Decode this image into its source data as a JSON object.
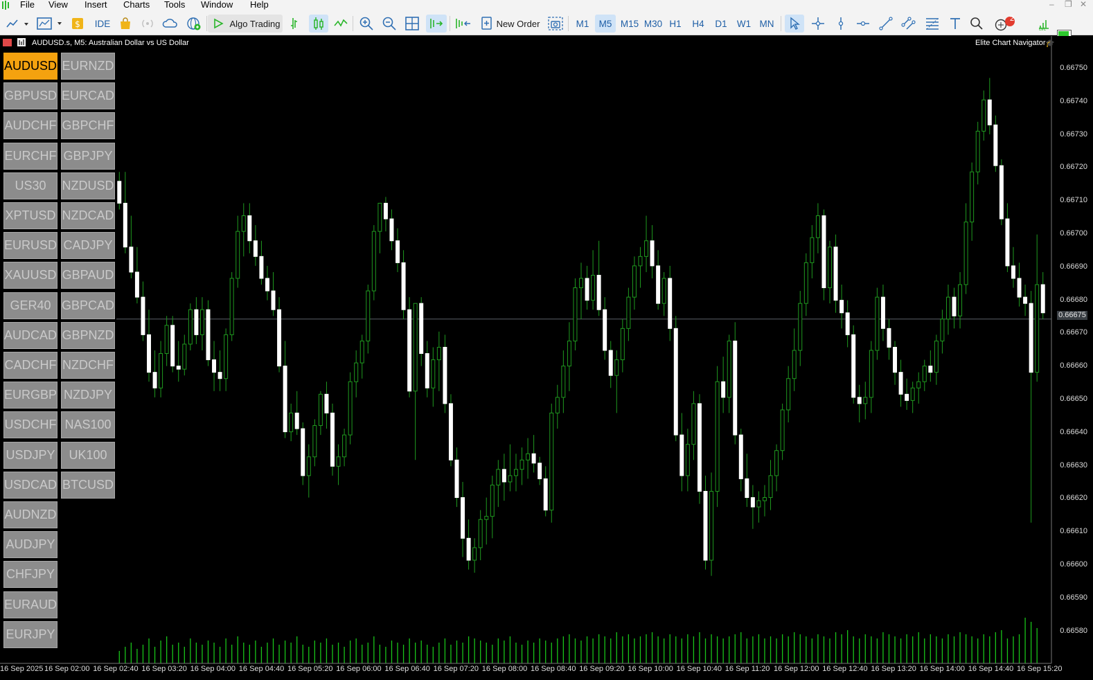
{
  "menu": [
    "File",
    "View",
    "Insert",
    "Charts",
    "Tools",
    "Window",
    "Help"
  ],
  "toolbar": {
    "ide": "IDE",
    "algo_trading": "Algo Trading",
    "new_order": "New Order",
    "timeframes": [
      "M1",
      "M5",
      "M15",
      "M30",
      "H1",
      "H4",
      "D1",
      "W1",
      "MN"
    ],
    "active_timeframe": "M5",
    "notification_count": "2"
  },
  "chart": {
    "title": "AUDUSD.s, M5:  Australian Dollar vs US Dollar",
    "navigator_label": "Elite Chart Navigator",
    "current_price": "0.66675",
    "price_ticks": [
      "0.66750",
      "0.66740",
      "0.66730",
      "0.66720",
      "0.66710",
      "0.66700",
      "0.66690",
      "0.66680",
      "0.66670",
      "0.66660",
      "0.66650",
      "0.66640",
      "0.66630",
      "0.66620",
      "0.66610",
      "0.66600",
      "0.66590",
      "0.66580"
    ],
    "time_ticks": [
      "16 Sep 2025",
      "16 Sep 02:00",
      "16 Sep 02:40",
      "16 Sep 03:20",
      "16 Sep 04:00",
      "16 Sep 04:40",
      "16 Sep 05:20",
      "16 Sep 06:00",
      "16 Sep 06:40",
      "16 Sep 07:20",
      "16 Sep 08:00",
      "16 Sep 08:40",
      "16 Sep 09:20",
      "16 Sep 10:00",
      "16 Sep 10:40",
      "16 Sep 11:20",
      "16 Sep 12:00",
      "16 Sep 12:40",
      "16 Sep 13:20",
      "16 Sep 14:00",
      "16 Sep 14:40",
      "16 Sep 15:20"
    ]
  },
  "symbols_col1": [
    "AUDUSD",
    "GBPUSD",
    "AUDCHF",
    "EURCHF",
    "US30",
    "XPTUSD",
    "EURUSD",
    "XAUUSD",
    "GER40",
    "AUDCAD",
    "CADCHF",
    "EURGBP",
    "USDCHF",
    "USDJPY",
    "USDCAD",
    "AUDNZD",
    "AUDJPY",
    "CHFJPY",
    "EURAUD",
    "EURJPY"
  ],
  "symbols_col2": [
    "EURNZD",
    "EURCAD",
    "GBPCHF",
    "GBPJPY",
    "NZDUSD",
    "NZDCAD",
    "CADJPY",
    "GBPAUD",
    "GBPCAD",
    "GBPNZD",
    "NZDCHF",
    "NZDJPY",
    "NAS100",
    "UK100",
    "BTCUSD"
  ],
  "active_symbol": "AUDUSD",
  "colors": {
    "candle_up": "#ffffff",
    "candle_down": "#ffffff",
    "wick": "#1f9a1f",
    "volume": "#19c419",
    "active_button": "#f4a20f"
  },
  "chart_data": {
    "type": "candlestick",
    "symbol": "AUDUSD.s",
    "timeframe": "M5",
    "ylim": [
      0.66575,
      0.66755
    ],
    "candles": [
      [
        0.66719,
        0.66722,
        0.6671,
        0.66712
      ],
      [
        0.66712,
        0.66722,
        0.66696,
        0.66698
      ],
      [
        0.66698,
        0.66708,
        0.66688,
        0.6669
      ],
      [
        0.6669,
        0.66698,
        0.6668,
        0.66682
      ],
      [
        0.66682,
        0.66687,
        0.66668,
        0.6667
      ],
      [
        0.6667,
        0.66678,
        0.66655,
        0.66658
      ],
      [
        0.66658,
        0.66665,
        0.6665,
        0.66653
      ],
      [
        0.66653,
        0.66668,
        0.6665,
        0.66664
      ],
      [
        0.66664,
        0.66676,
        0.6666,
        0.66673
      ],
      [
        0.66673,
        0.66676,
        0.66658,
        0.6666
      ],
      [
        0.6666,
        0.66668,
        0.66655,
        0.66659
      ],
      [
        0.66659,
        0.6667,
        0.66657,
        0.66667
      ],
      [
        0.66667,
        0.6668,
        0.66665,
        0.66678
      ],
      [
        0.66678,
        0.66682,
        0.66667,
        0.6667
      ],
      [
        0.6667,
        0.66682,
        0.66665,
        0.66678
      ],
      [
        0.66678,
        0.66681,
        0.6666,
        0.66662
      ],
      [
        0.66662,
        0.66668,
        0.66652,
        0.66658
      ],
      [
        0.66658,
        0.66665,
        0.66652,
        0.66656
      ],
      [
        0.66656,
        0.66672,
        0.66652,
        0.6667
      ],
      [
        0.6667,
        0.6669,
        0.66668,
        0.66688
      ],
      [
        0.66688,
        0.66708,
        0.66685,
        0.66703
      ],
      [
        0.66703,
        0.66712,
        0.66695,
        0.66708
      ],
      [
        0.66708,
        0.66712,
        0.66696,
        0.667
      ],
      [
        0.667,
        0.66705,
        0.66692,
        0.66695
      ],
      [
        0.66695,
        0.667,
        0.66686,
        0.66688
      ],
      [
        0.66688,
        0.66692,
        0.66681,
        0.66684
      ],
      [
        0.66684,
        0.6669,
        0.66676,
        0.66678
      ],
      [
        0.66678,
        0.66682,
        0.66658,
        0.6666
      ],
      [
        0.6666,
        0.66668,
        0.66637,
        0.66639
      ],
      [
        0.66639,
        0.66648,
        0.66636,
        0.66645
      ],
      [
        0.66645,
        0.66652,
        0.66638,
        0.6664
      ],
      [
        0.6664,
        0.66642,
        0.66622,
        0.66625
      ],
      [
        0.66625,
        0.66635,
        0.66618,
        0.66631
      ],
      [
        0.66631,
        0.66643,
        0.66628,
        0.66641
      ],
      [
        0.66641,
        0.66652,
        0.66638,
        0.66651
      ],
      [
        0.66651,
        0.66655,
        0.6664,
        0.66645
      ],
      [
        0.66645,
        0.66648,
        0.66625,
        0.66628
      ],
      [
        0.66628,
        0.66635,
        0.66622,
        0.66631
      ],
      [
        0.66631,
        0.6664,
        0.66628,
        0.66638
      ],
      [
        0.66638,
        0.66658,
        0.66635,
        0.66655
      ],
      [
        0.66655,
        0.66665,
        0.6665,
        0.66661
      ],
      [
        0.66661,
        0.6667,
        0.66656,
        0.66668
      ],
      [
        0.66668,
        0.66686,
        0.66664,
        0.66684
      ],
      [
        0.66684,
        0.66705,
        0.66681,
        0.66703
      ],
      [
        0.66703,
        0.66712,
        0.66696,
        0.66712
      ],
      [
        0.66712,
        0.66714,
        0.66703,
        0.66707
      ],
      [
        0.66707,
        0.6671,
        0.66697,
        0.667
      ],
      [
        0.667,
        0.66704,
        0.6669,
        0.66693
      ],
      [
        0.66693,
        0.66697,
        0.66675,
        0.66678
      ],
      [
        0.66678,
        0.66682,
        0.6665,
        0.66652
      ],
      [
        0.66652,
        0.66668,
        0.6663,
        0.6668
      ],
      [
        0.6668,
        0.66682,
        0.6666,
        0.66664
      ],
      [
        0.66664,
        0.66668,
        0.6665,
        0.66653
      ],
      [
        0.66653,
        0.66666,
        0.66647,
        0.66662
      ],
      [
        0.66662,
        0.66671,
        0.66652,
        0.66666
      ],
      [
        0.66666,
        0.6667,
        0.66645,
        0.66648
      ],
      [
        0.66648,
        0.66651,
        0.66628,
        0.6663
      ],
      [
        0.6663,
        0.66634,
        0.66615,
        0.66618
      ],
      [
        0.66618,
        0.66623,
        0.66599,
        0.66605
      ],
      [
        0.66605,
        0.66611,
        0.66595,
        0.66598
      ],
      [
        0.66598,
        0.66605,
        0.66594,
        0.66602
      ],
      [
        0.66602,
        0.66614,
        0.66598,
        0.66611
      ],
      [
        0.66611,
        0.66618,
        0.66603,
        0.66612
      ],
      [
        0.66612,
        0.66625,
        0.66605,
        0.66622
      ],
      [
        0.66622,
        0.6663,
        0.66615,
        0.66627
      ],
      [
        0.66627,
        0.66632,
        0.66617,
        0.66623
      ],
      [
        0.66623,
        0.66635,
        0.6662,
        0.66625
      ],
      [
        0.66625,
        0.66632,
        0.6662,
        0.66627
      ],
      [
        0.66627,
        0.66634,
        0.66622,
        0.6663
      ],
      [
        0.6663,
        0.66637,
        0.66624,
        0.66632
      ],
      [
        0.66632,
        0.66638,
        0.66626,
        0.66629
      ],
      [
        0.66629,
        0.66631,
        0.66622,
        0.66624
      ],
      [
        0.66624,
        0.66628,
        0.66612,
        0.66614
      ],
      [
        0.66614,
        0.66648,
        0.6661,
        0.66645
      ],
      [
        0.66645,
        0.66654,
        0.6664,
        0.6665
      ],
      [
        0.6665,
        0.66665,
        0.66645,
        0.6666
      ],
      [
        0.6666,
        0.66674,
        0.66652,
        0.66668
      ],
      [
        0.66668,
        0.66688,
        0.66665,
        0.66685
      ],
      [
        0.66685,
        0.66693,
        0.66675,
        0.66688
      ],
      [
        0.66688,
        0.66692,
        0.66678,
        0.66681
      ],
      [
        0.66681,
        0.66697,
        0.66678,
        0.66689
      ],
      [
        0.66689,
        0.667,
        0.66676,
        0.66678
      ],
      [
        0.66678,
        0.66682,
        0.66662,
        0.66665
      ],
      [
        0.66665,
        0.66668,
        0.66653,
        0.66657
      ],
      [
        0.66657,
        0.66665,
        0.66645,
        0.66662
      ],
      [
        0.66662,
        0.66675,
        0.66658,
        0.66672
      ],
      [
        0.66672,
        0.66685,
        0.66668,
        0.66682
      ],
      [
        0.66682,
        0.66695,
        0.66678,
        0.66692
      ],
      [
        0.66692,
        0.66698,
        0.66685,
        0.66695
      ],
      [
        0.66695,
        0.66708,
        0.6669,
        0.667
      ],
      [
        0.667,
        0.66705,
        0.66688,
        0.66692
      ],
      [
        0.66692,
        0.66697,
        0.66678,
        0.6668
      ],
      [
        0.6668,
        0.6669,
        0.66676,
        0.66688
      ],
      [
        0.66688,
        0.66692,
        0.66668,
        0.66672
      ],
      [
        0.66672,
        0.66676,
        0.66636,
        0.66638
      ],
      [
        0.66638,
        0.66645,
        0.6662,
        0.66625
      ],
      [
        0.66625,
        0.6664,
        0.6662,
        0.66635
      ],
      [
        0.66635,
        0.66652,
        0.6663,
        0.66648
      ],
      [
        0.66648,
        0.66651,
        0.66616,
        0.6662
      ],
      [
        0.6662,
        0.66625,
        0.66595,
        0.66598
      ],
      [
        0.66598,
        0.66626,
        0.66593,
        0.6662
      ],
      [
        0.6662,
        0.6666,
        0.66615,
        0.66655
      ],
      [
        0.66655,
        0.66663,
        0.66645,
        0.6665
      ],
      [
        0.6665,
        0.6667,
        0.66645,
        0.66668
      ],
      [
        0.66668,
        0.66674,
        0.66635,
        0.66638
      ],
      [
        0.66638,
        0.6664,
        0.6662,
        0.66624
      ],
      [
        0.66624,
        0.66632,
        0.66615,
        0.66618
      ],
      [
        0.66618,
        0.66622,
        0.66608,
        0.66615
      ],
      [
        0.66615,
        0.6662,
        0.6661,
        0.66617
      ],
      [
        0.66617,
        0.66622,
        0.66612,
        0.66618
      ],
      [
        0.66618,
        0.6663,
        0.66614,
        0.66625
      ],
      [
        0.66625,
        0.66635,
        0.6662,
        0.66633
      ],
      [
        0.66633,
        0.66648,
        0.6663,
        0.66646
      ],
      [
        0.66646,
        0.6666,
        0.66642,
        0.66656
      ],
      [
        0.66656,
        0.66672,
        0.66652,
        0.66665
      ],
      [
        0.66665,
        0.66684,
        0.6666,
        0.6668
      ],
      [
        0.6668,
        0.66696,
        0.66676,
        0.66693
      ],
      [
        0.66693,
        0.66705,
        0.66688,
        0.66701
      ],
      [
        0.66701,
        0.66712,
        0.66696,
        0.66708
      ],
      [
        0.66708,
        0.6671,
        0.66681,
        0.66685
      ],
      [
        0.66685,
        0.667,
        0.6668,
        0.66698
      ],
      [
        0.66698,
        0.66702,
        0.66677,
        0.66681
      ],
      [
        0.66681,
        0.66686,
        0.66672,
        0.66677
      ],
      [
        0.66677,
        0.66681,
        0.66666,
        0.6667
      ],
      [
        0.6667,
        0.66673,
        0.66648,
        0.6665
      ],
      [
        0.6665,
        0.66654,
        0.66642,
        0.66648
      ],
      [
        0.66648,
        0.66655,
        0.66643,
        0.6665
      ],
      [
        0.6665,
        0.66668,
        0.66645,
        0.66665
      ],
      [
        0.66665,
        0.66685,
        0.66662,
        0.66682
      ],
      [
        0.66682,
        0.66686,
        0.66668,
        0.66672
      ],
      [
        0.66672,
        0.66675,
        0.66662,
        0.66666
      ],
      [
        0.66666,
        0.66668,
        0.66654,
        0.66658
      ],
      [
        0.66658,
        0.66662,
        0.66647,
        0.66651
      ],
      [
        0.66651,
        0.66656,
        0.66646,
        0.66649
      ],
      [
        0.66649,
        0.66655,
        0.66645,
        0.66653
      ],
      [
        0.66653,
        0.66658,
        0.66648,
        0.66655
      ],
      [
        0.66655,
        0.66662,
        0.66652,
        0.6666
      ],
      [
        0.6666,
        0.66665,
        0.66655,
        0.66658
      ],
      [
        0.66658,
        0.6667,
        0.66654,
        0.66668
      ],
      [
        0.66668,
        0.66678,
        0.66664,
        0.66675
      ],
      [
        0.66675,
        0.66686,
        0.6667,
        0.66682
      ],
      [
        0.66682,
        0.66685,
        0.66672,
        0.66676
      ],
      [
        0.66676,
        0.6669,
        0.66672,
        0.66686
      ],
      [
        0.66686,
        0.66712,
        0.66683,
        0.66706
      ],
      [
        0.66706,
        0.66725,
        0.667,
        0.66722
      ],
      [
        0.66722,
        0.66738,
        0.66718,
        0.66735
      ],
      [
        0.66735,
        0.66748,
        0.66732,
        0.66745
      ],
      [
        0.66745,
        0.66752,
        0.66734,
        0.66737
      ],
      [
        0.66737,
        0.6674,
        0.66722,
        0.66724
      ],
      [
        0.66724,
        0.66726,
        0.66705,
        0.66707
      ],
      [
        0.66707,
        0.66712,
        0.6669,
        0.66692
      ],
      [
        0.66692,
        0.66698,
        0.66685,
        0.66688
      ],
      [
        0.66688,
        0.66693,
        0.66679,
        0.66682
      ],
      [
        0.66682,
        0.66686,
        0.66676,
        0.6668
      ],
      [
        0.6668,
        0.66684,
        0.6661,
        0.66658
      ],
      [
        0.66658,
        0.66702,
        0.66655,
        0.66686
      ],
      [
        0.66686,
        0.6669,
        0.66675,
        0.66677
      ]
    ],
    "volume": [
      6,
      8,
      10,
      7,
      9,
      12,
      8,
      11,
      13,
      9,
      10,
      8,
      12,
      10,
      9,
      11,
      10,
      8,
      12,
      9,
      13,
      10,
      9,
      11,
      8,
      10,
      12,
      9,
      11,
      10,
      13,
      9,
      8,
      11,
      10,
      12,
      9,
      10,
      8,
      11,
      12,
      9,
      10,
      13,
      9,
      8,
      11,
      10,
      9,
      12,
      10,
      11,
      9,
      8,
      10,
      12,
      9,
      11,
      10,
      13,
      12,
      11,
      10,
      9,
      12,
      11,
      13,
      10,
      9,
      11,
      10,
      12,
      11,
      10,
      12,
      13,
      14,
      12,
      11,
      13,
      12,
      14,
      13,
      12,
      15,
      13,
      14,
      12,
      13,
      14,
      15,
      13,
      12,
      14,
      13,
      12,
      14,
      13,
      15,
      12,
      14,
      13,
      12,
      13,
      14,
      15,
      12,
      13,
      14,
      12,
      13,
      12,
      14,
      13,
      15,
      14,
      13,
      12,
      14,
      13,
      12,
      15,
      14,
      16,
      13,
      12,
      14,
      13,
      12,
      15,
      14,
      13,
      12,
      14,
      13,
      15,
      12,
      14,
      13,
      12,
      14,
      13,
      15,
      14,
      13,
      12,
      14,
      13,
      15,
      16,
      12,
      13,
      14,
      22,
      20,
      17
    ]
  }
}
